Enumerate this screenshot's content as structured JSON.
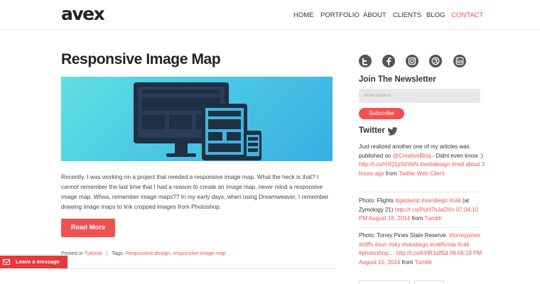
{
  "header": {
    "logo": "avex",
    "nav": [
      {
        "label": "HOME",
        "active": false
      },
      {
        "label": "PORTFOLIO",
        "active": false
      },
      {
        "label": "ABOUT",
        "active": false
      },
      {
        "label": "CLIENTS",
        "active": false
      },
      {
        "label": "BLOG",
        "active": false
      },
      {
        "label": "CONTACT",
        "active": true
      }
    ]
  },
  "post": {
    "title": "Responsive Image Map",
    "excerpt": "Recently, I was working on a project that needed a responsive image map. What the heck is that? I cannot remember the last time that I had a reason to create an image map, never mind a responsive image map. Whoa, remember image maps?? In my early days, when using Dreamweaver, I remember drawing image maps to link cropped images from Photoshop.",
    "read_more": "Read More",
    "meta": {
      "posted_in_label": "Posted in",
      "category": "Tutorial",
      "separator": "|",
      "tags_label": "Tags:",
      "tags": [
        "Responsive design",
        "responsive image map"
      ]
    }
  },
  "sidebar": {
    "social_icons": [
      "twitter-icon",
      "facebook-icon",
      "instagram-icon",
      "dribbble-icon",
      "linkedin-icon"
    ],
    "newsletter": {
      "title": "Join The Newsletter",
      "email_placeholder": "email address",
      "subscribe_label": "Subscribe"
    },
    "twitter": {
      "title": "Twitter",
      "tweets": [
        {
          "segments": [
            {
              "text": "Just realized another one of my articles was published on ",
              "link": false
            },
            {
              "text": "@CreativeBloq",
              "link": true
            },
            {
              "text": " - Didnt even know :) ",
              "link": false
            },
            {
              "text": "http://t.co/rHQ1pS0VeN",
              "link": true
            },
            {
              "text": " ",
              "link": false
            },
            {
              "text": "#webdesign",
              "link": true
            },
            {
              "text": " ",
              "link": false
            },
            {
              "text": "#rwd",
              "link": true
            },
            {
              "text": " ",
              "link": false
            },
            {
              "text": "about 3 hours ago",
              "link": true
            },
            {
              "text": " from ",
              "link": false
            },
            {
              "text": "Twitter Web Client",
              "link": true
            }
          ]
        },
        {
          "segments": [
            {
              "text": "Photo: Flights ",
              "link": false
            },
            {
              "text": "#gaslamp",
              "link": true
            },
            {
              "text": " ",
              "link": false
            },
            {
              "text": "#sandiego",
              "link": true
            },
            {
              "text": " ",
              "link": false
            },
            {
              "text": "#cali",
              "link": true
            },
            {
              "text": " (at Zymology 21) ",
              "link": false
            },
            {
              "text": "http://t.co/PuH7hJaOVn",
              "link": true
            },
            {
              "text": " ",
              "link": false
            },
            {
              "text": "07:04:10 PM August 16, 2014",
              "link": true
            },
            {
              "text": " from ",
              "link": false
            },
            {
              "text": "Tumblr",
              "link": true
            }
          ]
        },
        {
          "segments": [
            {
              "text": "Photo: Torrey Pines State Reserve. ",
              "link": false
            },
            {
              "text": "#torreypines",
              "link": true
            },
            {
              "text": " ",
              "link": false
            },
            {
              "text": "#cliffs",
              "link": true
            },
            {
              "text": " ",
              "link": false
            },
            {
              "text": "#sun",
              "link": true
            },
            {
              "text": " ",
              "link": false
            },
            {
              "text": "#sky",
              "link": true
            },
            {
              "text": " ",
              "link": false
            },
            {
              "text": "#sandiego",
              "link": true
            },
            {
              "text": " ",
              "link": false
            },
            {
              "text": "#california",
              "link": true
            },
            {
              "text": " ",
              "link": false
            },
            {
              "text": "#cali",
              "link": true
            },
            {
              "text": " ",
              "link": false
            },
            {
              "text": "#photoshop",
              "link": true
            },
            {
              "text": "… ",
              "link": false
            },
            {
              "text": "http://t.co/kVlR1slf5d",
              "link": true
            },
            {
              "text": " ",
              "link": false
            },
            {
              "text": "09:06:19 PM August 15, 2014",
              "link": true
            },
            {
              "text": " from ",
              "link": false
            },
            {
              "text": "Tumblr",
              "link": true
            }
          ]
        }
      ]
    }
  },
  "widget": {
    "leave_message": "Leave a message",
    "icon": "mail-icon"
  },
  "colors": {
    "accent": "#f0524f",
    "text": "#333333",
    "hero_gradient_start": "#5fe0e0",
    "hero_gradient_end": "#3aaee3",
    "illustration": "#1f2f44"
  }
}
